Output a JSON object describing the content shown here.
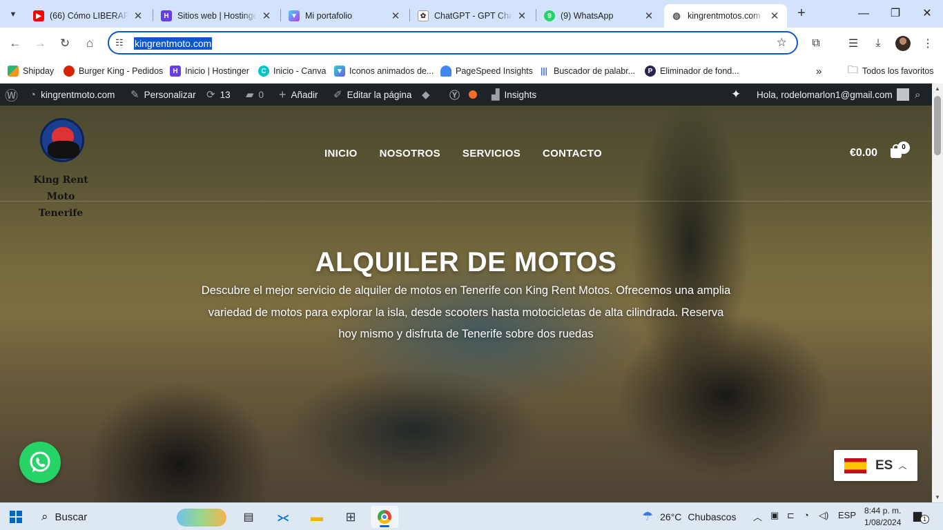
{
  "browser": {
    "tabs": [
      {
        "title": "(66) Cómo LIBERAR M",
        "favicon": "youtube-icon"
      },
      {
        "title": "Sitios web | Hostinger",
        "favicon": "hostinger-icon"
      },
      {
        "title": "Mi portafolio",
        "favicon": "vite-icon"
      },
      {
        "title": "ChatGPT - GPT Chat G",
        "favicon": "chatgpt-icon"
      },
      {
        "title": "(9) WhatsApp",
        "favicon": "whatsapp-icon"
      },
      {
        "title": "kingrentmotos.com -",
        "favicon": "globe-icon",
        "active": true
      }
    ],
    "address": "kingrentmoto.com",
    "bookmarks": [
      {
        "label": "Shipday",
        "icon": "shipday-icon"
      },
      {
        "label": "Burger King - Pedidos",
        "icon": "burger-king-icon"
      },
      {
        "label": "Inicio | Hostinger",
        "icon": "hostinger-icon"
      },
      {
        "label": "Inicio - Canva",
        "icon": "canva-icon"
      },
      {
        "label": "Iconos animados de...",
        "icon": "vite-icon"
      },
      {
        "label": "PageSpeed Insights",
        "icon": "pagespeed-icon"
      },
      {
        "label": "Buscador de palabr...",
        "icon": "audio-bars-icon"
      },
      {
        "label": "Eliminador de fond...",
        "icon": "remove-bg-icon"
      }
    ],
    "all_bookmarks": "Todos los favoritos"
  },
  "admin_bar": {
    "site_name": "kingrentmoto.com",
    "customize": "Personalizar",
    "updates": "13",
    "comments": "0",
    "add_new": "Añadir",
    "edit_page": "Editar la página",
    "insights": "Insights",
    "greeting": "Hola, rodelomarlon1@gmail.com"
  },
  "site": {
    "logo_line1": "King Rent Moto",
    "logo_line2": "Tenerife",
    "nav": [
      "INICIO",
      "NOSOTROS",
      "SERVICIOS",
      "CONTACTO"
    ],
    "cart_total": "€0.00",
    "cart_count": "0",
    "hero_title": "ALQUILER DE MOTOS",
    "hero_text": "Descubre el mejor servicio de alquiler de motos en Tenerife con King Rent Motos. Ofrecemos una amplia variedad de motos para explorar la isla, desde scooters hasta motocicletas de alta cilindrada. Reserva hoy mismo y disfruta de Tenerife sobre dos ruedas",
    "language_code": "ES"
  },
  "taskbar": {
    "search_label": "Buscar",
    "temperature": "26°C",
    "weather": "Chubascos",
    "keyboard_lang": "ESP",
    "time": "8:44 p. m.",
    "date": "1/08/2024",
    "notification_count": "1"
  },
  "colors": {
    "chrome_tabstrip": "#d3e3fd",
    "omnibox_focus": "#0b57d0",
    "wp_adminbar": "#1d2327",
    "whatsapp_green": "#25d366"
  }
}
